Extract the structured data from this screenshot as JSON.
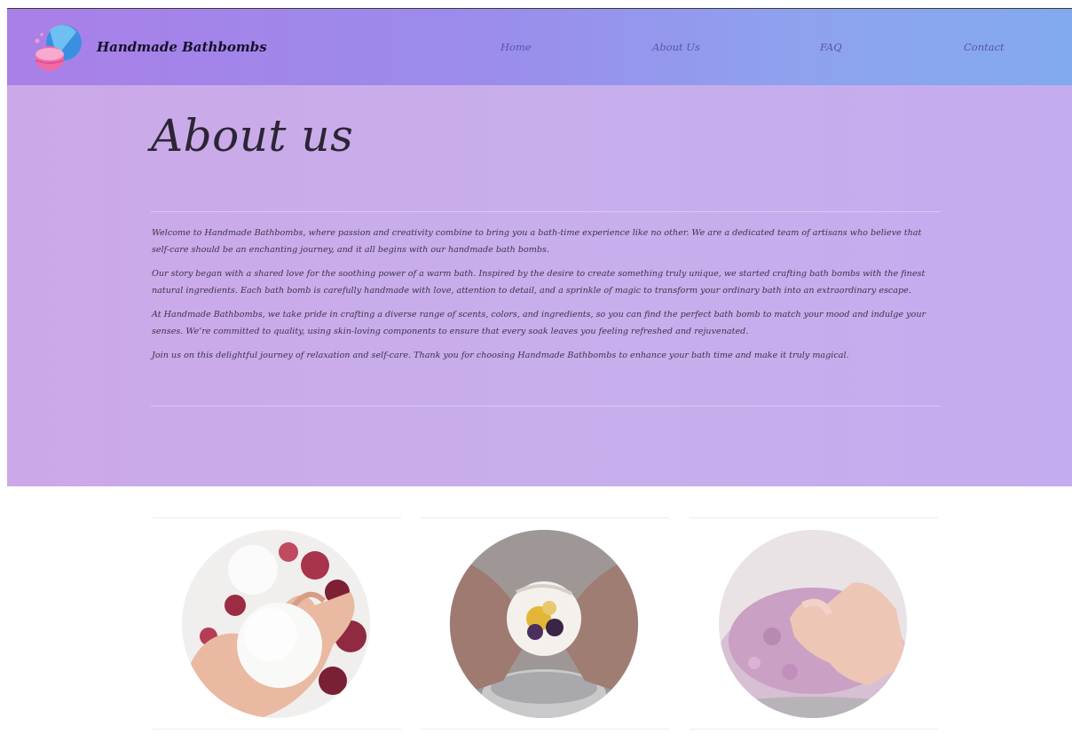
{
  "header": {
    "brand": "Handmade Bathbombs",
    "logo_icon": "bathbomb-logo-icon",
    "nav": [
      "Home",
      "About Us",
      "FAQ",
      "Contact"
    ],
    "gradient": [
      "#a97fe8",
      "#82aaee"
    ]
  },
  "about": {
    "title": "About us",
    "paragraphs": [
      "Welcome to Handmade Bathbombs, where passion and creativity combine to bring you a bath-time experience like no other. We are a dedicated team of artisans who believe that self-care should be an enchanting journey, and it all begins with our handmade bath bombs.",
      "Our story began with a shared love for the soothing power of a warm bath. Inspired by the desire to create something truly unique, we started crafting bath bombs with the finest natural ingredients. Each bath bomb is carefully handmade with love, attention to detail, and a sprinkle of magic to transform your ordinary bath into an extraordinary escape.",
      "At Handmade Bathbombs, we take pride in crafting a diverse range of scents, colors, and ingredients, so you can find the perfect bath bomb to match your mood and indulge your senses. We’re committed to quality, using skin-loving components to ensure that every soak leaves you feeling refreshed and rejuvenated.",
      "Join us on this delightful journey of relaxation and self-care. Thank you for choosing Handmade Bathbombs to enhance your bath time and make it truly magical."
    ]
  },
  "gallery": {
    "images": [
      "white-bathbomb-in-hand-photo",
      "flower-bathbomb-in-hands-photo",
      "pink-bathbomb-mixture-photo"
    ]
  }
}
